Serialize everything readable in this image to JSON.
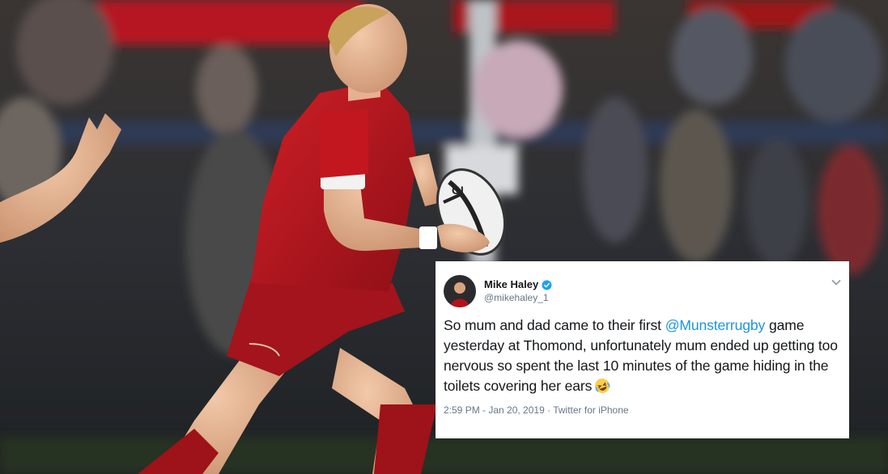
{
  "tweet": {
    "display_name": "Mike Haley",
    "handle": "@mikehaley_1",
    "text_part1": "So mum and dad came to their first ",
    "mention": "@Munsterrugby",
    "text_part2": " game yesterday at Thomond, unfortunately mum ended up getting too nervous so spent the last 10 minutes of the game hiding in the toilets covering her ears",
    "emoji": "rolling-on-floor-laughing",
    "meta": "2:59 PM - Jan 20, 2019 · Twitter for iPhone"
  },
  "photo": {
    "ball_brand": "GI",
    "colors": {
      "jersey": "#b3121b",
      "stands_red": "#c21b24",
      "crowd_dark": "#2b2d31"
    }
  },
  "colors": {
    "link": "#1b95e0",
    "verified": "#1da1f2",
    "secondary": "#657786"
  }
}
